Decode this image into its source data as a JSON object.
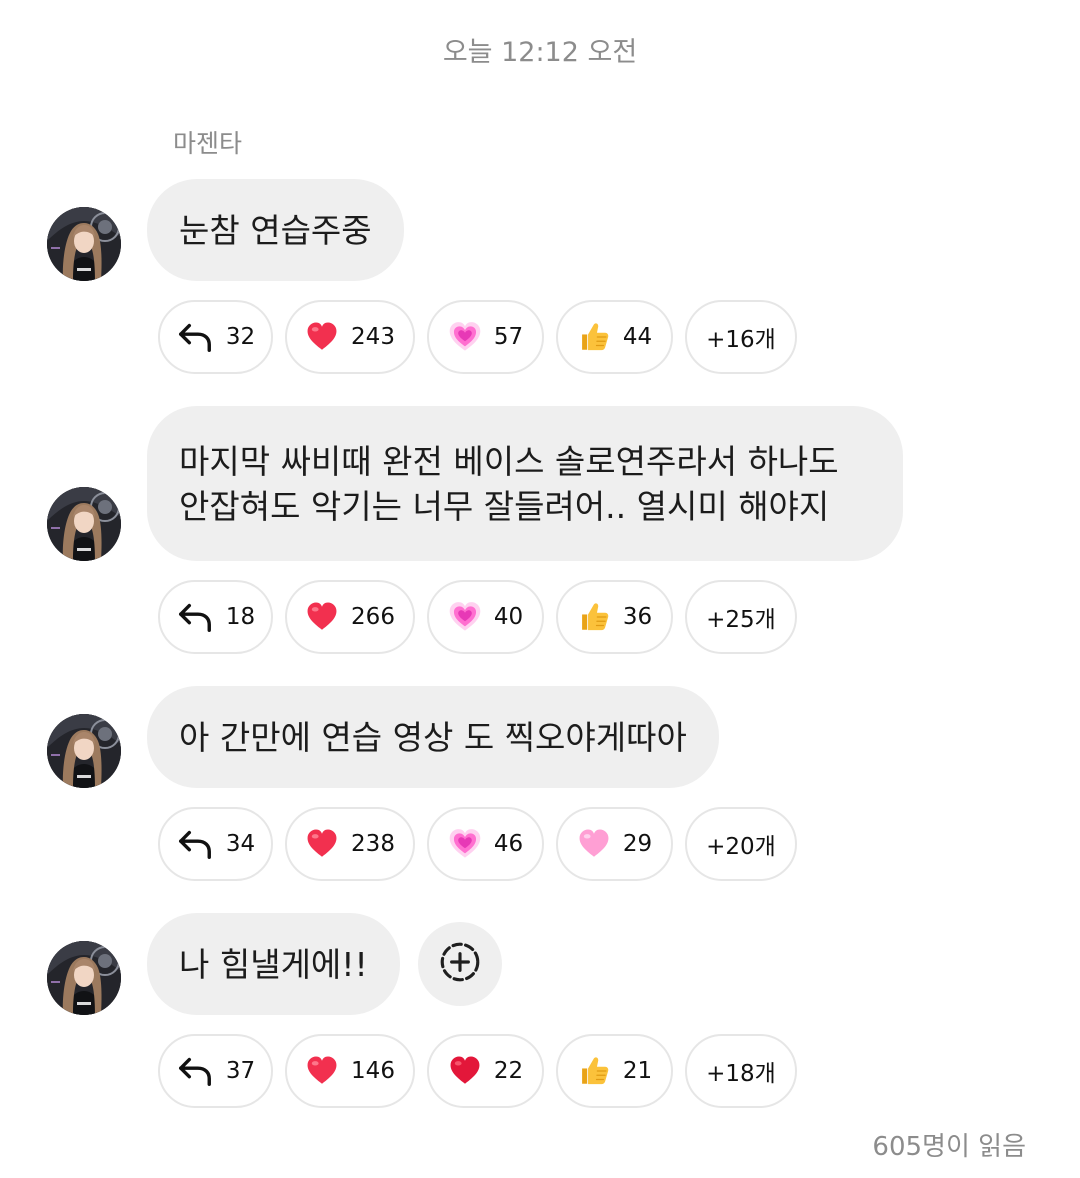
{
  "header": {
    "timestamp": "오늘 12:12 오전"
  },
  "sender": {
    "name": "마젠타"
  },
  "messages": [
    {
      "text": "눈참 연습주중",
      "reactions": {
        "reply": "32",
        "r1": "243",
        "r2": "57",
        "r3": "44",
        "more": "+16개"
      },
      "reaction_icons": [
        "reply-arrow-icon",
        "red-heart-icon",
        "pink-sparkle-heart-icon",
        "thumbs-up-icon"
      ]
    },
    {
      "text": "마지막 싸비때 완전 베이스 솔로연주라서 하나도\n안잡혀도 악기는 너무 잘들려어.. 열시미 해야지",
      "reactions": {
        "reply": "18",
        "r1": "266",
        "r2": "40",
        "r3": "36",
        "more": "+25개"
      },
      "reaction_icons": [
        "reply-arrow-icon",
        "red-heart-icon",
        "pink-sparkle-heart-icon",
        "thumbs-up-icon"
      ]
    },
    {
      "text": "아 간만에 연습 영상 도 찍오야게따아",
      "reactions": {
        "reply": "34",
        "r1": "238",
        "r2": "46",
        "r3": "29",
        "more": "+20개"
      },
      "reaction_icons": [
        "reply-arrow-icon",
        "red-heart-icon",
        "pink-sparkle-heart-icon",
        "pink-heart-icon"
      ]
    },
    {
      "text": "나 힘낼게에!!",
      "reactions": {
        "reply": "37",
        "r1": "146",
        "r2": "22",
        "r3": "21",
        "more": "+18개"
      },
      "reaction_icons": [
        "reply-arrow-icon",
        "red-heart-icon",
        "crimson-heart-icon",
        "thumbs-up-icon"
      ]
    }
  ],
  "footer": {
    "read_count": "605명이 읽음"
  },
  "colors": {
    "bubble": "#efefef",
    "meta_text": "#8c8c8c",
    "heart_red": "#f2304f",
    "heart_pink": "#ff8fd0",
    "thumb_yellow": "#f4b32b"
  }
}
